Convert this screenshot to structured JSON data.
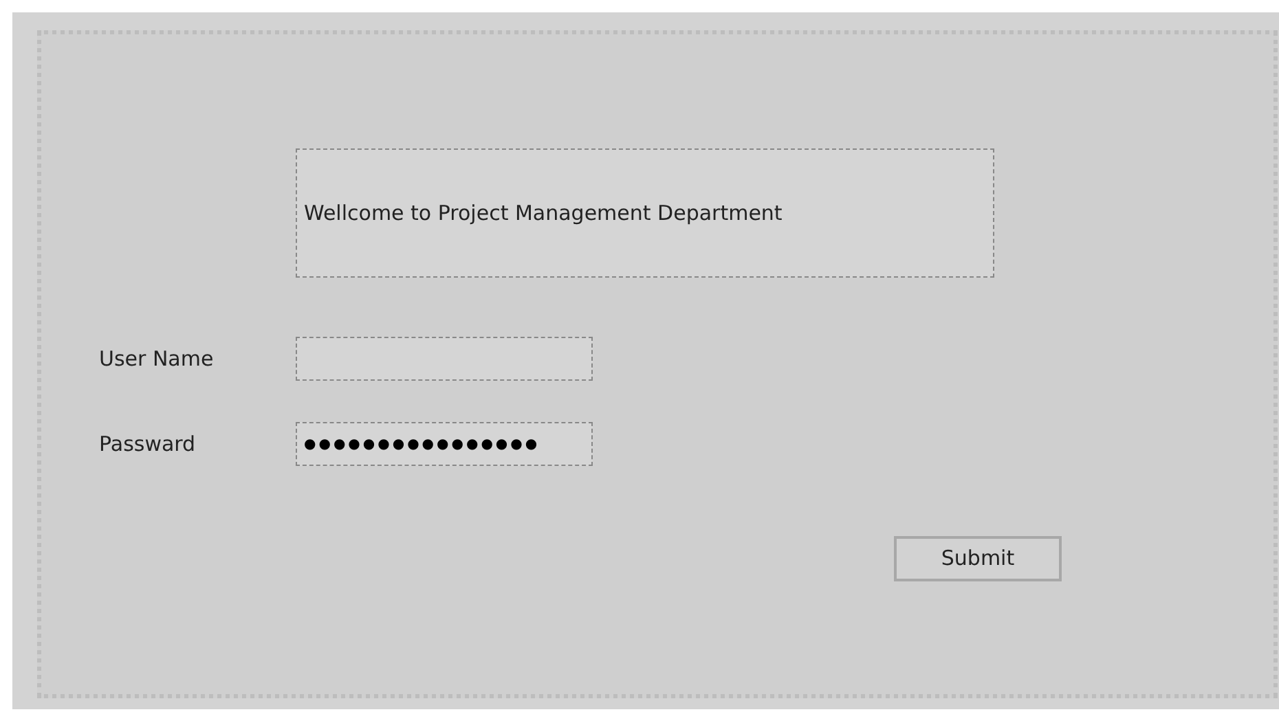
{
  "banner": {
    "text": "Wellcome to Project Management Department"
  },
  "fields": [
    {
      "label": "User Name"
    },
    {
      "label": "Passward",
      "value": "●●●●●●●●●●●●●●●●"
    }
  ],
  "submit_button": {
    "label": "Submit"
  }
}
